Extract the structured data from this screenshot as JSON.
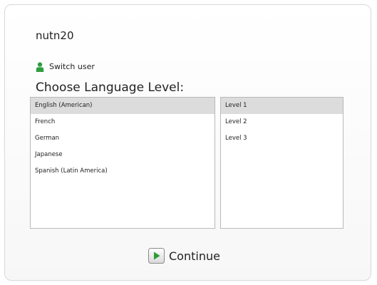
{
  "user": {
    "name": "nutn20",
    "switch_label": "Switch user",
    "switch_icon": "user-icon",
    "switch_icon_color": "#2f9e3f"
  },
  "heading": "Choose Language Level:",
  "languages": {
    "selected_index": 0,
    "items": [
      "English (American)",
      "French",
      "German",
      "Japanese",
      "Spanish (Latin America)"
    ]
  },
  "levels": {
    "selected_index": 0,
    "items": [
      "Level 1",
      "Level 2",
      "Level 3"
    ]
  },
  "continue": {
    "label": "Continue",
    "icon": "play-icon",
    "icon_color": "#2e9a3a"
  },
  "colors": {
    "selected_row": "#dcdcdc",
    "list_border": "#b9b9b9"
  }
}
